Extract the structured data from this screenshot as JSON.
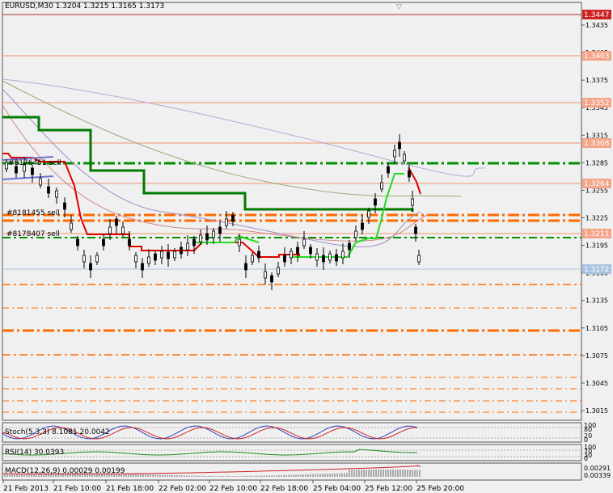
{
  "title": "EURUSD,M30  1.3204 1.3215 1.3165 1.3173",
  "colors": {
    "background": "#f0f0f0",
    "grid_orange": "#ff6a00",
    "line_green": "#007a00",
    "line_lime": "#22dd22",
    "line_red": "#e00000",
    "bid_line": "#a8c4e0",
    "label_salmon": "#f4a58a",
    "label_red": "#cc2222"
  },
  "price_axis": {
    "ticks": [
      "1.3435",
      "1.3405",
      "1.3375",
      "1.3345",
      "1.3315",
      "1.3285",
      "1.3255",
      "1.3225",
      "1.3195",
      "1.3165",
      "1.3135",
      "1.3105",
      "1.3075",
      "1.3045",
      "1.3015"
    ],
    "labels": {
      "top_red": "1.3447",
      "l1": "1.3403",
      "l2": "1.3352",
      "l3": "1.3308",
      "l4": "1.3264",
      "l5": "1.3211",
      "current": "1.3172"
    }
  },
  "orders": {
    "o1": "#8176451 sell",
    "o2": "#8181455 sell",
    "o3": "#8178407 sell"
  },
  "time_axis": [
    "21 Feb 2013",
    "21 Feb 10:00",
    "21 Feb 18:00",
    "22 Feb 02:00",
    "22 Feb 10:00",
    "22 Feb 18:00",
    "25 Feb 04:00",
    "25 Feb 12:00",
    "25 Feb 20:00"
  ],
  "indicators": {
    "stoch": {
      "label": "Stoch(5,3,3) 8.1081 20.0042",
      "scale": [
        "100",
        "80",
        "20",
        "0"
      ]
    },
    "rsi": {
      "label": "RSI(14) 30.0393",
      "scale": [
        "100",
        "70",
        "30",
        "0"
      ]
    },
    "macd": {
      "label": "MACD(12,26,9) 0.00029 0.00199",
      "scale": [
        "0.00291",
        "0.00339"
      ]
    }
  }
}
